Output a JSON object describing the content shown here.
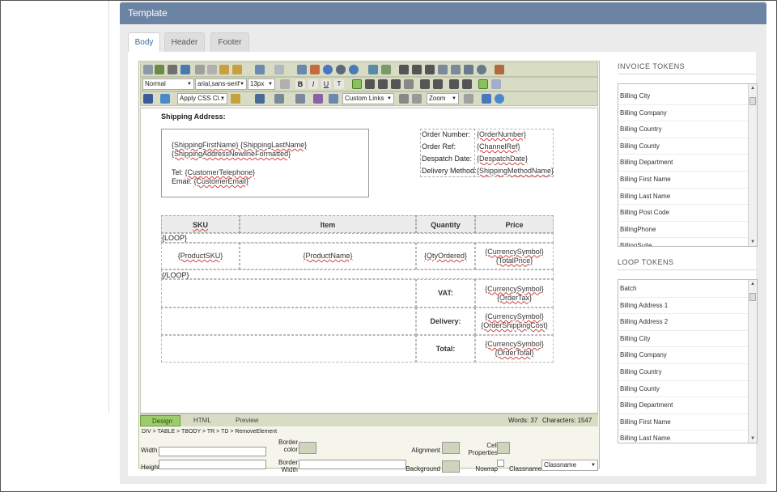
{
  "panel": {
    "title": "Template"
  },
  "tabs": [
    {
      "label": "Body",
      "active": true
    },
    {
      "label": "Header"
    },
    {
      "label": "Footer"
    }
  ],
  "toolbar": {
    "paragraph_format": "Normal",
    "font_name": "arial,sans-serif",
    "font_size": "13px",
    "css_class": "Apply CSS Cl...",
    "custom_links": "Custom Links",
    "zoom": "Zoom"
  },
  "document": {
    "shipping_heading": "Shipping Address:",
    "address": {
      "line1": "{ShippingFirstName} {ShippingLastName}",
      "line2": "{ShippingAddressNewlineFormatted}",
      "tel_label": "Tel:",
      "tel_value": "{CustomerTelephone}",
      "email_label": "Email:",
      "email_value": "{CustomerEmail}"
    },
    "order_info": [
      {
        "label": "Order Number:",
        "value": "{OrderNumber}"
      },
      {
        "label": "Order Ref:",
        "value": "{ChannelRef}"
      },
      {
        "label": "Despatch Date:",
        "value": "{DespatchDate}"
      },
      {
        "label": "Delivery Method:",
        "value": "{ShippingMethodName}"
      }
    ],
    "table": {
      "headers": [
        "SKU",
        "Item",
        "Quantity",
        "Price"
      ],
      "loop_start": "{LOOP}",
      "loop_end": "{/LOOP}",
      "row": {
        "sku": "{ProductSKU}",
        "item": "{ProductName}",
        "qty": "{QtyOrdered}",
        "price1": "{CurrencySymbol}",
        "price2": "{TotalPrice}"
      },
      "totals": [
        {
          "label": "VAT:",
          "v1": "{CurrencySymbol}",
          "v2": "{OrderTax}"
        },
        {
          "label": "Delivery:",
          "v1": "{CurrencySymbol}",
          "v2": "{OrderShippingCost}"
        },
        {
          "label": "Total:",
          "v1": "{CurrencySymbol}",
          "v2": "{OrderTotal}"
        }
      ]
    }
  },
  "status": {
    "modes": [
      {
        "label": "Design",
        "active": true
      },
      {
        "label": "HTML"
      },
      {
        "label": "Preview"
      }
    ],
    "words": "Words: 37",
    "characters": "Characters: 1547",
    "breadcrumb": "DIV > TABLE > TBODY > TR > TD > RemoveElement"
  },
  "properties": {
    "width": "Width",
    "height": "Height",
    "border_color": "Border color",
    "border_width": "Border Width",
    "alignment": "Alignment",
    "background": "Background",
    "cell_properties": "Cell Properties",
    "nowrap": "Nowrap",
    "classname_label": "Classname",
    "classname_value": "Classname"
  },
  "invoice_tokens": {
    "title": "INVOICE TOKENS",
    "items": [
      "Billing City",
      "Billing Company",
      "Billing Country",
      "Billing County",
      "Billing Department",
      "Billing First Name",
      "Billing Last Name",
      "Billing Post Code",
      "BillingPhone",
      "BillingSuite"
    ]
  },
  "loop_tokens": {
    "title": "LOOP TOKENS",
    "items": [
      "Batch",
      "Billing Address 1",
      "Billing Address 2",
      "Billing City",
      "Billing Company",
      "Billing Country",
      "Billing County",
      "Billing Department",
      "Billing First Name",
      "Billing Last Name"
    ]
  }
}
